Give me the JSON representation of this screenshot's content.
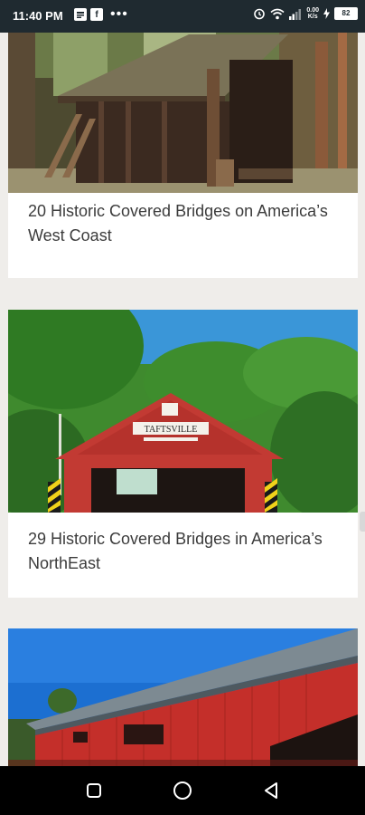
{
  "status_bar": {
    "time": "11:40 PM",
    "left_icons": [
      "message-icon",
      "facebook-icon"
    ],
    "facebook_glyph": "f",
    "more_dots": "•••",
    "right_icons": [
      "alarm-icon",
      "wifi-icon",
      "signal-icon",
      "data-speed-icon",
      "charging-icon",
      "battery-icon"
    ],
    "data_speed_top": "0.00",
    "data_speed_bottom": "K/s",
    "battery_level": "82"
  },
  "cards": [
    {
      "title": "20 Historic Covered Bridges on America’s West Coast",
      "image": "dark-wooden-covered-bridge-forest"
    },
    {
      "title": "29 Historic Covered Bridges in America’s NorthEast",
      "image": "red-covered-bridge-green-trees",
      "sign_text": "TAFTSVILLE"
    },
    {
      "title": "",
      "image": "long-red-covered-bridge-blue-sky"
    }
  ],
  "nav_bar": {
    "buttons": [
      "recent-apps-icon",
      "home-icon",
      "back-icon"
    ]
  },
  "colors": {
    "status_bar": "#1f2a30",
    "background": "#efedea",
    "card": "#ffffff",
    "title_text": "#3c3c3c",
    "bridge_red": "#c23a33"
  }
}
